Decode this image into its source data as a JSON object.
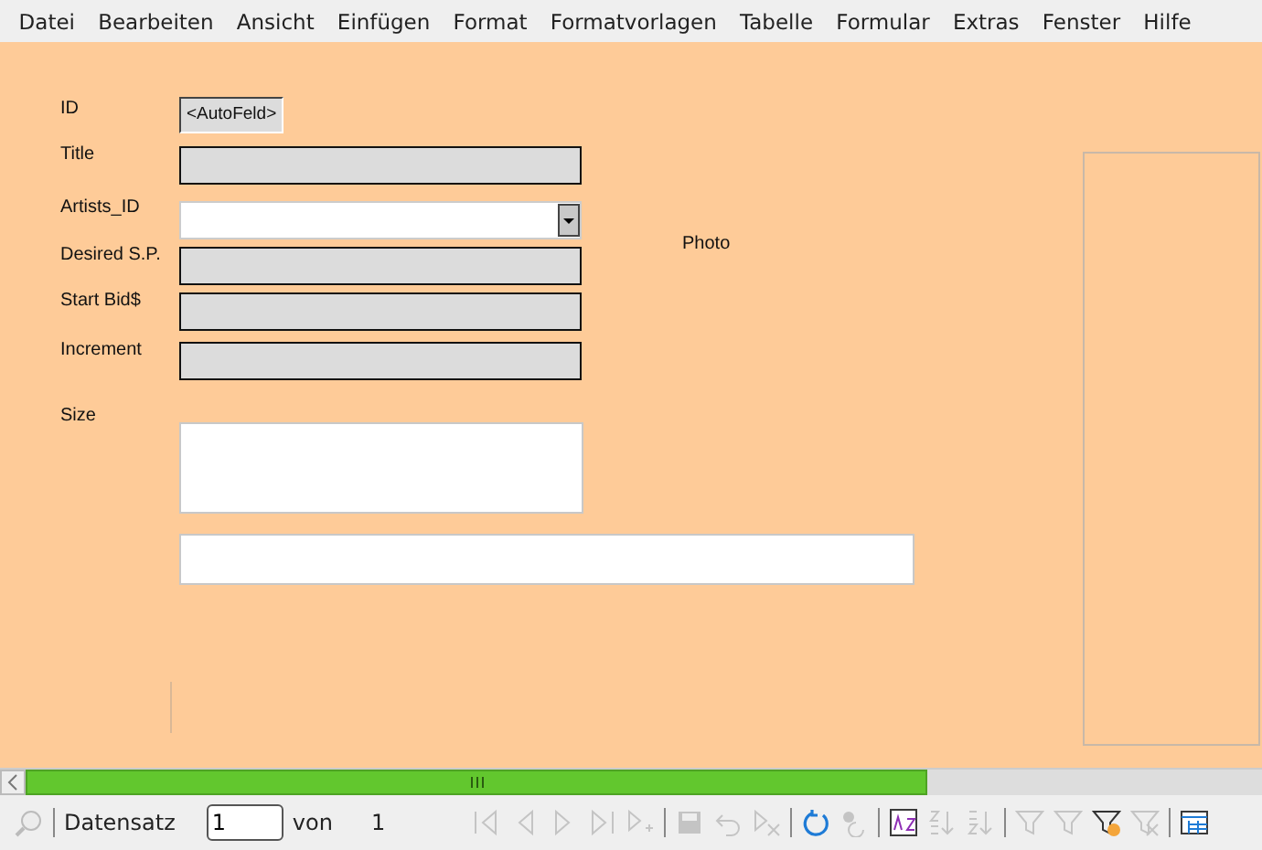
{
  "menu": [
    "Datei",
    "Bearbeiten",
    "Ansicht",
    "Einfügen",
    "Format",
    "Formatvorlagen",
    "Tabelle",
    "Formular",
    "Extras",
    "Fenster",
    "Hilfe"
  ],
  "form": {
    "fields": [
      {
        "label": "ID",
        "kind": "auto",
        "value": "<AutoFeld>"
      },
      {
        "label": "Title",
        "kind": "text"
      },
      {
        "label": "Artists_ID",
        "kind": "list"
      },
      {
        "label": "Desired S.P.",
        "kind": "text"
      },
      {
        "label": "Start Bid$",
        "kind": "text"
      },
      {
        "label": "Increment",
        "kind": "text"
      },
      {
        "label": "Size",
        "kind": "memo"
      }
    ],
    "photo_label": "Photo"
  },
  "scrollbar": {
    "level": 0.73
  },
  "navigation": {
    "record_label": "Datensatz",
    "record_value": "1",
    "of_label": "von",
    "total": "1",
    "tools": [
      {
        "kind": "first",
        "disabled": true
      },
      {
        "kind": "prev",
        "disabled": true
      },
      {
        "kind": "next",
        "disabled": true
      },
      {
        "kind": "last",
        "disabled": true
      },
      {
        "kind": "new",
        "disabled": true
      },
      {
        "kind": "sep"
      },
      {
        "kind": "save",
        "disabled": true
      },
      {
        "kind": "undo",
        "disabled": true
      },
      {
        "kind": "delete",
        "disabled": true
      },
      {
        "kind": "sep"
      },
      {
        "kind": "refresh",
        "disabled": false
      },
      {
        "kind": "refresh-control",
        "disabled": true
      },
      {
        "kind": "sep"
      },
      {
        "kind": "sort",
        "disabled": false
      },
      {
        "kind": "sort-asc",
        "disabled": true
      },
      {
        "kind": "sort-desc",
        "disabled": true
      },
      {
        "kind": "sep"
      },
      {
        "kind": "autofilter",
        "disabled": true
      },
      {
        "kind": "filter",
        "disabled": true
      },
      {
        "kind": "standard-filter",
        "disabled": false
      },
      {
        "kind": "remove-filter",
        "disabled": true
      },
      {
        "kind": "sep"
      },
      {
        "kind": "table",
        "disabled": false
      }
    ]
  }
}
